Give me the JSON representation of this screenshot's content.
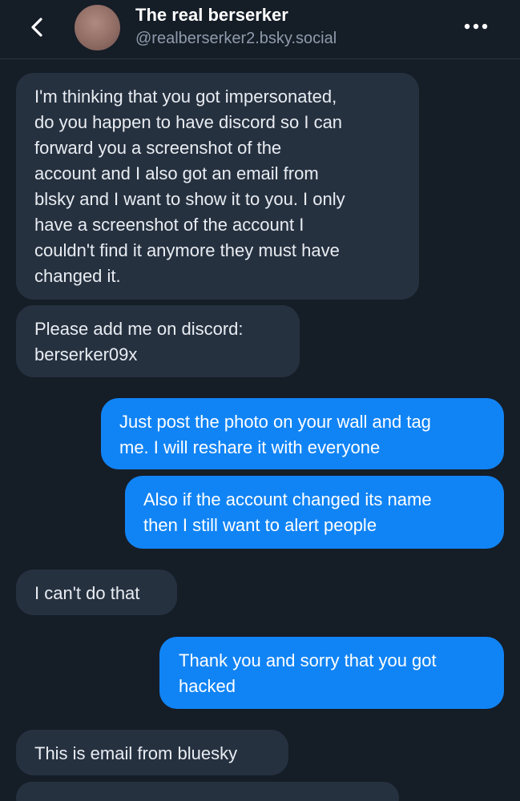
{
  "header": {
    "back_icon": "chevron-left-icon",
    "title": "The real berserker",
    "handle": "@realberserker2.bsky.social",
    "more_icon": "ellipsis-icon"
  },
  "messages": [
    {
      "direction": "incoming",
      "text": "I'm thinking that you got impersonated,\ndo you happen to have discord so I can\nforward you a screenshot of the\naccount and I also got an email from\nblsky and I want to show it to you. I only\nhave a screenshot of the account I\ncouldn't find it anymore they must have\nchanged it."
    },
    {
      "direction": "incoming",
      "text": "Please add me on discord:\nberserker09x"
    },
    {
      "direction": "outgoing",
      "text": "Just post the photo on your wall and tag\nme. I will reshare it with everyone"
    },
    {
      "direction": "outgoing",
      "text": "Also if the account changed its name\nthen I still want to alert people"
    },
    {
      "direction": "incoming",
      "text": "I can't do that"
    },
    {
      "direction": "outgoing",
      "text": "Thank you and sorry that you got\nhacked"
    },
    {
      "direction": "incoming",
      "text": "This is email from bluesky"
    }
  ],
  "colors": {
    "background": "#151d27",
    "incoming_bubble": "#263140",
    "outgoing_bubble": "#1184f5",
    "secondary_text": "#8f9bab"
  }
}
